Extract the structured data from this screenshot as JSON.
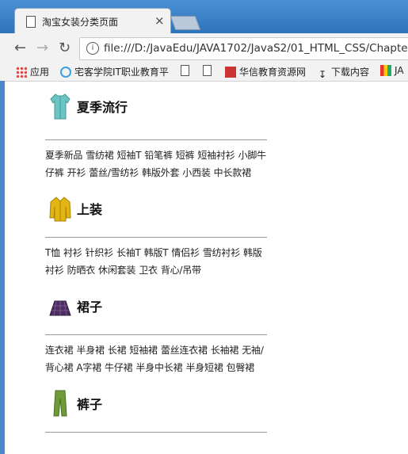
{
  "browser": {
    "tab_title": "淘宝女装分类页面",
    "close_glyph": "×",
    "url": "file:///D:/JavaEdu/JAVA1702/JavaS2/01_HTML_CSS/Chapte"
  },
  "bookmarks": [
    {
      "label": "应用",
      "icon": "apps-grid-icon"
    },
    {
      "label": "宅客学院IT职业教育平",
      "icon": "zhaike-logo-icon"
    },
    {
      "label": "",
      "icon": "page-icon"
    },
    {
      "label": "",
      "icon": "page-icon"
    },
    {
      "label": "华信教育资源网",
      "icon": "huaxin-logo-icon"
    },
    {
      "label": "下载内容",
      "icon": "download-icon"
    },
    {
      "label": "JA",
      "icon": "java-logo-icon"
    }
  ],
  "sections": [
    {
      "title": "夏季流行",
      "icon": "shirt-icon",
      "icon_color": "#6cc4c4",
      "links": [
        "夏季新品",
        "雪纺裙",
        "短袖T",
        "铅笔裤",
        "短裤",
        "短袖衬衫",
        "小脚牛仔裤",
        "开衫",
        "蕾丝/雪纺衫",
        "韩版外套",
        "小西装",
        "中长款裙"
      ]
    },
    {
      "title": "上装",
      "icon": "jacket-icon",
      "icon_color": "#e2b512",
      "links": [
        "T恤",
        "衬衫",
        "针织衫",
        "长袖T",
        "韩版T",
        "情侣衫",
        "雪纺衬衫",
        "韩版衬衫",
        "防晒衣",
        "休闲套装",
        "卫衣",
        "背心/吊带"
      ]
    },
    {
      "title": "裙子",
      "icon": "skirt-icon",
      "icon_color": "#4a2e5e",
      "links": [
        "连衣裙",
        "半身裙",
        "长裙",
        "短袖裙",
        "蕾丝连衣裙",
        "长袖裙",
        "无袖/背心裙",
        "A字裙",
        "牛仔裙",
        "半身中长裙",
        "半身短裙",
        "包臀裙"
      ]
    },
    {
      "title": "裤子",
      "icon": "pants-icon",
      "icon_color": "#6f9a3a",
      "links": []
    }
  ]
}
